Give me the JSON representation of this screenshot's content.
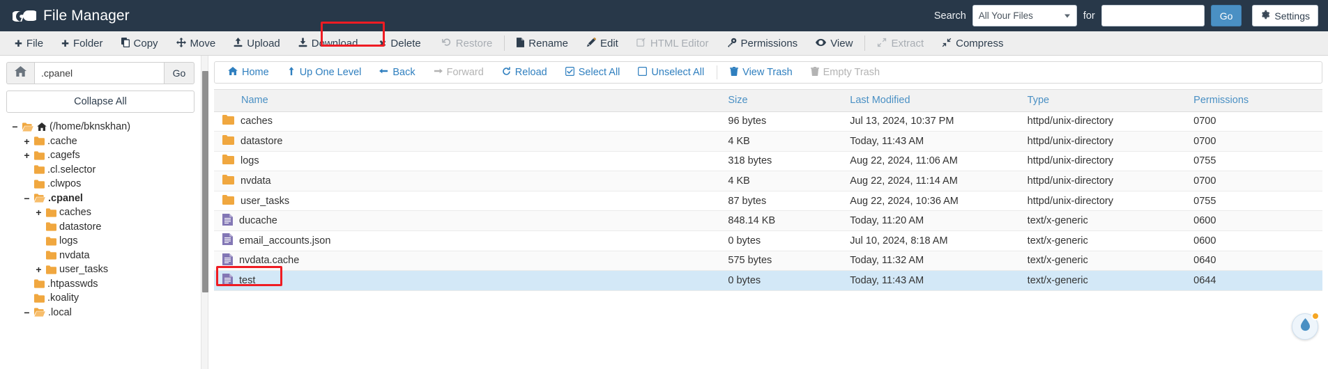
{
  "header": {
    "app_title": "File Manager",
    "logo_icon": "cpanel-logo",
    "search_label": "Search",
    "search_scope_value": "All Your Files",
    "search_scope_options": [
      "All Your Files"
    ],
    "for_label": "for",
    "search_value": "",
    "search_placeholder": "",
    "go_label": "Go",
    "settings_label": "Settings",
    "settings_icon": "gear-icon",
    "bg_color": "#283849"
  },
  "toolbar": {
    "items": [
      {
        "label": "File",
        "icon": "plus-icon",
        "disabled": false
      },
      {
        "label": "Folder",
        "icon": "plus-icon",
        "disabled": false
      },
      {
        "label": "Copy",
        "icon": "copy-icon",
        "disabled": false
      },
      {
        "label": "Move",
        "icon": "move-arrows-icon",
        "disabled": false
      },
      {
        "label": "Upload",
        "icon": "upload-icon",
        "disabled": false
      },
      {
        "label": "Download",
        "icon": "download-icon",
        "disabled": false
      },
      {
        "label": "Delete",
        "icon": "x-mark-icon",
        "disabled": false
      },
      {
        "label": "Restore",
        "icon": "undo-icon",
        "disabled": true
      },
      {
        "label": "Rename",
        "icon": "file-icon",
        "disabled": false
      },
      {
        "label": "Edit",
        "icon": "pencil-icon",
        "disabled": false
      },
      {
        "label": "HTML Editor",
        "icon": "html-edit-icon",
        "disabled": true
      },
      {
        "label": "Permissions",
        "icon": "key-icon",
        "disabled": false
      },
      {
        "label": "View",
        "icon": "eye-icon",
        "disabled": false
      },
      {
        "label": "Extract",
        "icon": "expand-icon",
        "disabled": true
      },
      {
        "label": "Compress",
        "icon": "compress-icon",
        "disabled": false
      }
    ],
    "highlight_color": "#ef1c23",
    "highlighted_item": "Delete"
  },
  "sidebar": {
    "home_icon": "home-icon",
    "path_value": ".cpanel",
    "path_placeholder": "",
    "go_label": "Go",
    "collapse_all_label": "Collapse All",
    "tree": [
      {
        "label": "(/home/bknskhan)",
        "depth": 0,
        "twisty": "minus",
        "folder": "open",
        "home": true,
        "bold": false
      },
      {
        "label": ".cache",
        "depth": 1,
        "twisty": "plus",
        "folder": "closed",
        "home": false,
        "bold": false
      },
      {
        "label": ".cagefs",
        "depth": 1,
        "twisty": "plus",
        "folder": "closed",
        "home": false,
        "bold": false
      },
      {
        "label": ".cl.selector",
        "depth": 1,
        "twisty": "none",
        "folder": "closed",
        "home": false,
        "bold": false
      },
      {
        "label": ".clwpos",
        "depth": 1,
        "twisty": "none",
        "folder": "closed",
        "home": false,
        "bold": false
      },
      {
        "label": ".cpanel",
        "depth": 1,
        "twisty": "minus",
        "folder": "open",
        "home": false,
        "bold": true
      },
      {
        "label": "caches",
        "depth": 2,
        "twisty": "plus",
        "folder": "closed",
        "home": false,
        "bold": false
      },
      {
        "label": "datastore",
        "depth": 2,
        "twisty": "none",
        "folder": "closed",
        "home": false,
        "bold": false
      },
      {
        "label": "logs",
        "depth": 2,
        "twisty": "none",
        "folder": "closed",
        "home": false,
        "bold": false
      },
      {
        "label": "nvdata",
        "depth": 2,
        "twisty": "none",
        "folder": "closed",
        "home": false,
        "bold": false
      },
      {
        "label": "user_tasks",
        "depth": 2,
        "twisty": "plus",
        "folder": "closed",
        "home": false,
        "bold": false
      },
      {
        "label": ".htpasswds",
        "depth": 1,
        "twisty": "none",
        "folder": "closed",
        "home": false,
        "bold": false
      },
      {
        "label": ".koality",
        "depth": 1,
        "twisty": "none",
        "folder": "closed",
        "home": false,
        "bold": false
      },
      {
        "label": ".local",
        "depth": 1,
        "twisty": "minus",
        "folder": "open",
        "home": false,
        "bold": false
      }
    ]
  },
  "nav": {
    "items": [
      {
        "label": "Home",
        "icon": "home-icon",
        "disabled": false
      },
      {
        "label": "Up One Level",
        "icon": "up-arrow-icon",
        "disabled": false
      },
      {
        "label": "Back",
        "icon": "left-arrow-icon",
        "disabled": false
      },
      {
        "label": "Forward",
        "icon": "right-arrow-icon",
        "disabled": true
      },
      {
        "label": "Reload",
        "icon": "reload-icon",
        "disabled": false
      },
      {
        "label": "Select All",
        "icon": "checkbox-checked-icon",
        "disabled": false
      },
      {
        "label": "Unselect All",
        "icon": "checkbox-empty-icon",
        "disabled": false
      },
      {
        "label": "View Trash",
        "icon": "trash-icon",
        "disabled": false
      },
      {
        "label": "Empty Trash",
        "icon": "trash-icon",
        "disabled": true
      }
    ]
  },
  "table": {
    "columns": [
      "Name",
      "Size",
      "Last Modified",
      "Type",
      "Permissions"
    ],
    "rows": [
      {
        "name": "caches",
        "icon": "folder-icon",
        "size": "96 bytes",
        "modified": "Jul 13, 2024, 10:37 PM",
        "type": "httpd/unix-directory",
        "permissions": "0700",
        "selected": false
      },
      {
        "name": "datastore",
        "icon": "folder-icon",
        "size": "4 KB",
        "modified": "Today, 11:43 AM",
        "type": "httpd/unix-directory",
        "permissions": "0700",
        "selected": false
      },
      {
        "name": "logs",
        "icon": "folder-icon",
        "size": "318 bytes",
        "modified": "Aug 22, 2024, 11:06 AM",
        "type": "httpd/unix-directory",
        "permissions": "0755",
        "selected": false
      },
      {
        "name": "nvdata",
        "icon": "folder-icon",
        "size": "4 KB",
        "modified": "Aug 22, 2024, 11:14 AM",
        "type": "httpd/unix-directory",
        "permissions": "0700",
        "selected": false
      },
      {
        "name": "user_tasks",
        "icon": "folder-icon",
        "size": "87 bytes",
        "modified": "Aug 22, 2024, 10:36 AM",
        "type": "httpd/unix-directory",
        "permissions": "0755",
        "selected": false
      },
      {
        "name": "ducache",
        "icon": "file-icon",
        "size": "848.14 KB",
        "modified": "Today, 11:20 AM",
        "type": "text/x-generic",
        "permissions": "0600",
        "selected": false
      },
      {
        "name": "email_accounts.json",
        "icon": "file-icon",
        "size": "0 bytes",
        "modified": "Jul 10, 2024, 8:18 AM",
        "type": "text/x-generic",
        "permissions": "0600",
        "selected": false
      },
      {
        "name": "nvdata.cache",
        "icon": "file-icon",
        "size": "575 bytes",
        "modified": "Today, 11:32 AM",
        "type": "text/x-generic",
        "permissions": "0640",
        "selected": false
      },
      {
        "name": "test",
        "icon": "file-icon",
        "size": "0 bytes",
        "modified": "Today, 11:43 AM",
        "type": "text/x-generic",
        "permissions": "0644",
        "selected": true
      }
    ],
    "highlighted_row": "test",
    "highlight_color": "#ef1c23"
  },
  "help": {
    "icon": "water-drop-icon",
    "badge_color": "#f5a623"
  }
}
